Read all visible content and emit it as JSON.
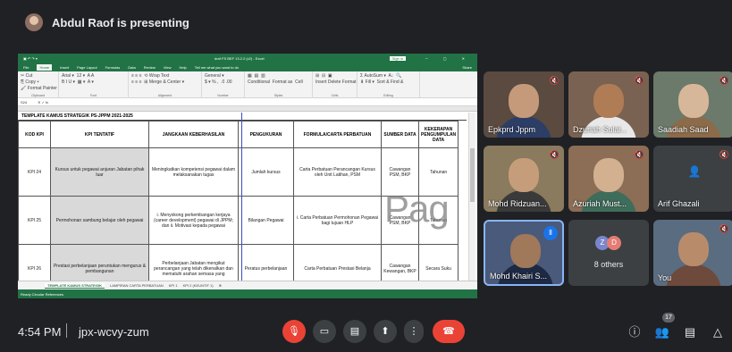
{
  "banner": {
    "presenter_text": "Abdul Raof is presenting"
  },
  "excel": {
    "title_doc": "draf FS BEF 13.2.2 (v2) - Excel",
    "sign_in": "Sign in",
    "window_controls": "─ ▢ ✕",
    "menu": [
      "File",
      "Home",
      "Insert",
      "Page Layout",
      "Formulas",
      "Data",
      "Review",
      "View",
      "Help",
      "Tell me what you want to do"
    ],
    "menu_active": "Home",
    "share": "Share",
    "ribbon_groups": [
      {
        "glyphs": "✂ Cut\n⎘ Copy ▾\n🖌 Format Painter",
        "label": "Clipboard"
      },
      {
        "glyphs": "Arial ▾  12 ▾  A A\nB I U ▾  ▦ ▾  A ▾",
        "label": "Font"
      },
      {
        "glyphs": "≡ ≡ ≡  ⟲ Wrap Text\n≡ ≡ ≡  ⊞ Merge & Center ▾",
        "label": "Alignment"
      },
      {
        "glyphs": "General ▾\n$ ▾ % ,  .0 .00",
        "label": "Number"
      },
      {
        "glyphs": "▦  ▤  ▥\nConditional  Format as  Cell",
        "label": "Styles"
      },
      {
        "glyphs": "⊞  ⊟  ▣\nInsert Delete Format",
        "label": "Cells"
      },
      {
        "glyphs": "Σ AutoSum ▾  A↓  🔍\n⬇ Fill ▾  Sort & Find &",
        "label": "Editing"
      }
    ],
    "name_box": "S24",
    "formula_icons": "✕  ✓  fx",
    "sheet_title": "TEMPLATE KAMUS STRATEGIK PS-JPPM 2021-2025",
    "headers": [
      "KOD KPI",
      "KPI TENTATIF",
      "JANGKAAN KEBERHASILAN",
      "PENGUKURAN",
      "FORMULA/CARTA PERBATUAN",
      "SUMBER DATA",
      "KEKERAPAN PENGUMPULAN DATA"
    ],
    "rows": [
      [
        "KPI 24",
        "Kursus untuk pegawai anjuran Jabatan pihak luar",
        "Meningkatkan kompetensi pegawai dalam melaksanakan tugas",
        "Jumlah kursus",
        "Carta Perbatuan Perancangan Kursus oleh Unit Latihan, PSM",
        "Cawangan PSM, BKP",
        "Tahunan"
      ],
      [
        "KPI 25",
        "Permohonan sambung belajar oleh pegawai",
        "i. Menyokong perkembangan kerjaya (career development) pegawai di JPPM; dan ii. Motivasi kepada pegawai",
        "Bilangan Pegawai",
        "i. Carta Perbatuan Permohonan Pegawai bagi tujuan HLP",
        "Cawangan PSM, BKP",
        "Tahunan"
      ],
      [
        "KPI 26",
        "Prestasi perbelanjaan peruntukan mengurus & pembangunan",
        "Perbelanjaan Jabatan mengikut perancangan yang telah dikenalkan dan mematuhi arahan semasa yang",
        "Peratus perbelanjaan",
        "Carta Perbatuan Prestasi Belanja",
        "Cawangan Kewangan, BKP",
        "Secara Suku"
      ]
    ],
    "watermark": "Pag",
    "tabs": [
      "TEMPLATE KAMUS STRATEGIK",
      "LAMPIRAN CARTA PERBATUAN",
      "KPI 1",
      "KPI 2 (KEUNTIF 1)",
      "⊕"
    ],
    "status": "Ready   Circular References"
  },
  "participants": [
    {
      "name": "Epkprd Jppm",
      "muted": true,
      "bg": "#5a4a40",
      "face": "#c49a7a",
      "body": "#2d3e66"
    },
    {
      "name": "Dzuriah Sulai...",
      "muted": true,
      "bg": "#7a6252",
      "face": "#b07c55",
      "body": "#e8e8e8"
    },
    {
      "name": "Saadiah Saad",
      "muted": true,
      "bg": "#6b7a6a",
      "face": "#d7b79a",
      "body": "#8c6b4a"
    },
    {
      "name": "Mohd Ridzuan...",
      "muted": true,
      "bg": "#8a7a5e",
      "face": "#c69d7a",
      "body": "#3a3a3a"
    },
    {
      "name": "Azuriah Must...",
      "muted": true,
      "bg": "#8c6d55",
      "face": "#d2b090",
      "body": "#3f6d5b"
    },
    {
      "name": "Arif Ghazali",
      "muted": true,
      "bg": "#3c4043",
      "face": "#3c4043",
      "body": "#3c4043"
    },
    {
      "name": "Mohd Khairi S...",
      "speaking": true,
      "bg": "#4a5a7a",
      "face": "#a0785a",
      "body": "#1e2a44"
    },
    {
      "name": "8 others",
      "others": true
    },
    {
      "name": "You",
      "muted": true,
      "bg": "#5a6c80",
      "face": "#b88c6a",
      "body": "#6e4a3c"
    }
  ],
  "others_avatars": [
    {
      "initial": "Z",
      "color": "#7986cb"
    },
    {
      "initial": "D",
      "color": "#e67c73"
    }
  ],
  "arif_initial": "👤",
  "bottombar": {
    "time": "4:54 PM",
    "meeting_code": "jpx-wcvy-zum",
    "participant_count": "17",
    "controls": {
      "mic": "🎙",
      "camera": "▭",
      "captions": "▤",
      "present": "⬆",
      "more": "⋮",
      "leave": "☎"
    },
    "right_icons": {
      "info": "ⓘ",
      "people": "👥",
      "chat": "▤",
      "activities": "△"
    }
  }
}
